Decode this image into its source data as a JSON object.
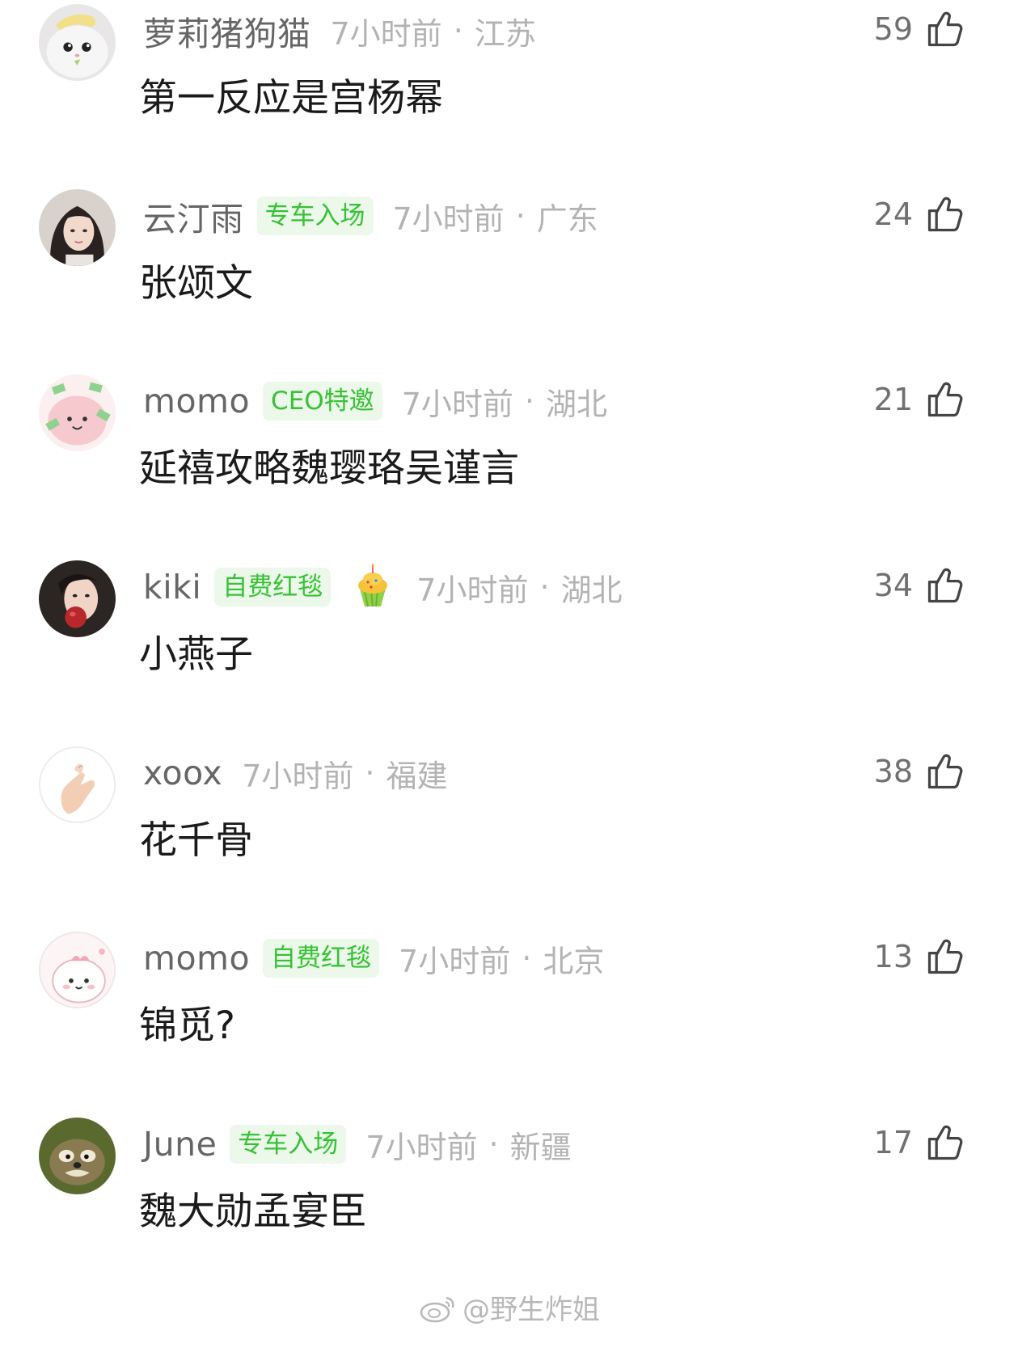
{
  "comments": [
    {
      "username": "萝莉猪狗猫",
      "badge": "",
      "time": "7小时前",
      "location": "江苏",
      "text": "第一反应是宫杨幂",
      "likes": "59",
      "avatar_icon": "cat-avatar-icon"
    },
    {
      "username": "云汀雨",
      "badge": "专车入场",
      "time": "7小时前",
      "location": "广东",
      "text": "张颂文",
      "likes": "24",
      "avatar_icon": "woman-avatar-icon"
    },
    {
      "username": "momo",
      "badge": "CEO特邀",
      "time": "7小时前",
      "location": "湖北",
      "text": "延禧攻略魏璎珞吴谨言",
      "likes": "21",
      "avatar_icon": "money-blob-avatar-icon"
    },
    {
      "username": "kiki",
      "badge": "自费红毯",
      "time": "7小时前",
      "location": "湖北",
      "text": "小燕子",
      "likes": "34",
      "avatar_icon": "woman-apple-avatar-icon"
    },
    {
      "username": "xoox",
      "badge": "",
      "time": "7小时前",
      "location": "福建",
      "text": "花千骨",
      "likes": "38",
      "avatar_icon": "finger-heart-avatar-icon"
    },
    {
      "username": "momo",
      "badge": "自费红毯",
      "time": "7小时前",
      "location": "北京",
      "text": "锦觅?",
      "likes": "13",
      "avatar_icon": "pink-blob-avatar-icon"
    },
    {
      "username": "June",
      "badge": "专车入场",
      "time": "7小时前",
      "location": "新疆",
      "text": "魏大勋孟宴臣",
      "likes": "17",
      "avatar_icon": "cartoon-mouse-avatar-icon"
    }
  ],
  "separator": "·",
  "extra_badge_icon": "cupcake-icon",
  "watermark": "@野生炸姐",
  "colors": {
    "badge_bg": "#ebf8ea",
    "badge_text": "#36c234",
    "meta_text": "#b3b3b3",
    "username": "#666666"
  }
}
